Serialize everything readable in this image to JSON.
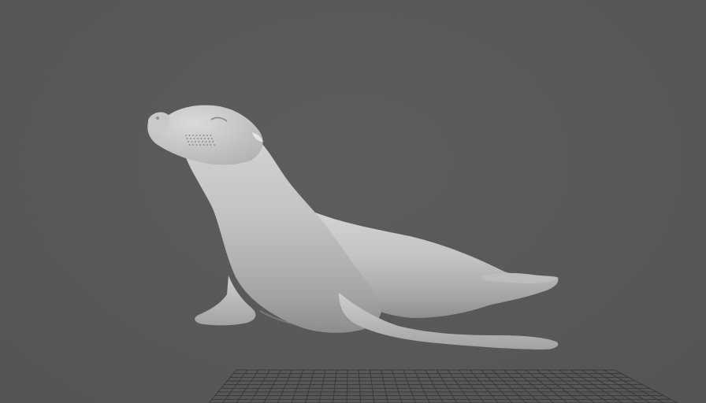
{
  "viewport": {
    "background_color": "#5a5a5a",
    "grid_color": "#3a3a3a",
    "model_color": "#b9b9b9",
    "model_name_icon": "sea-lion-model"
  }
}
